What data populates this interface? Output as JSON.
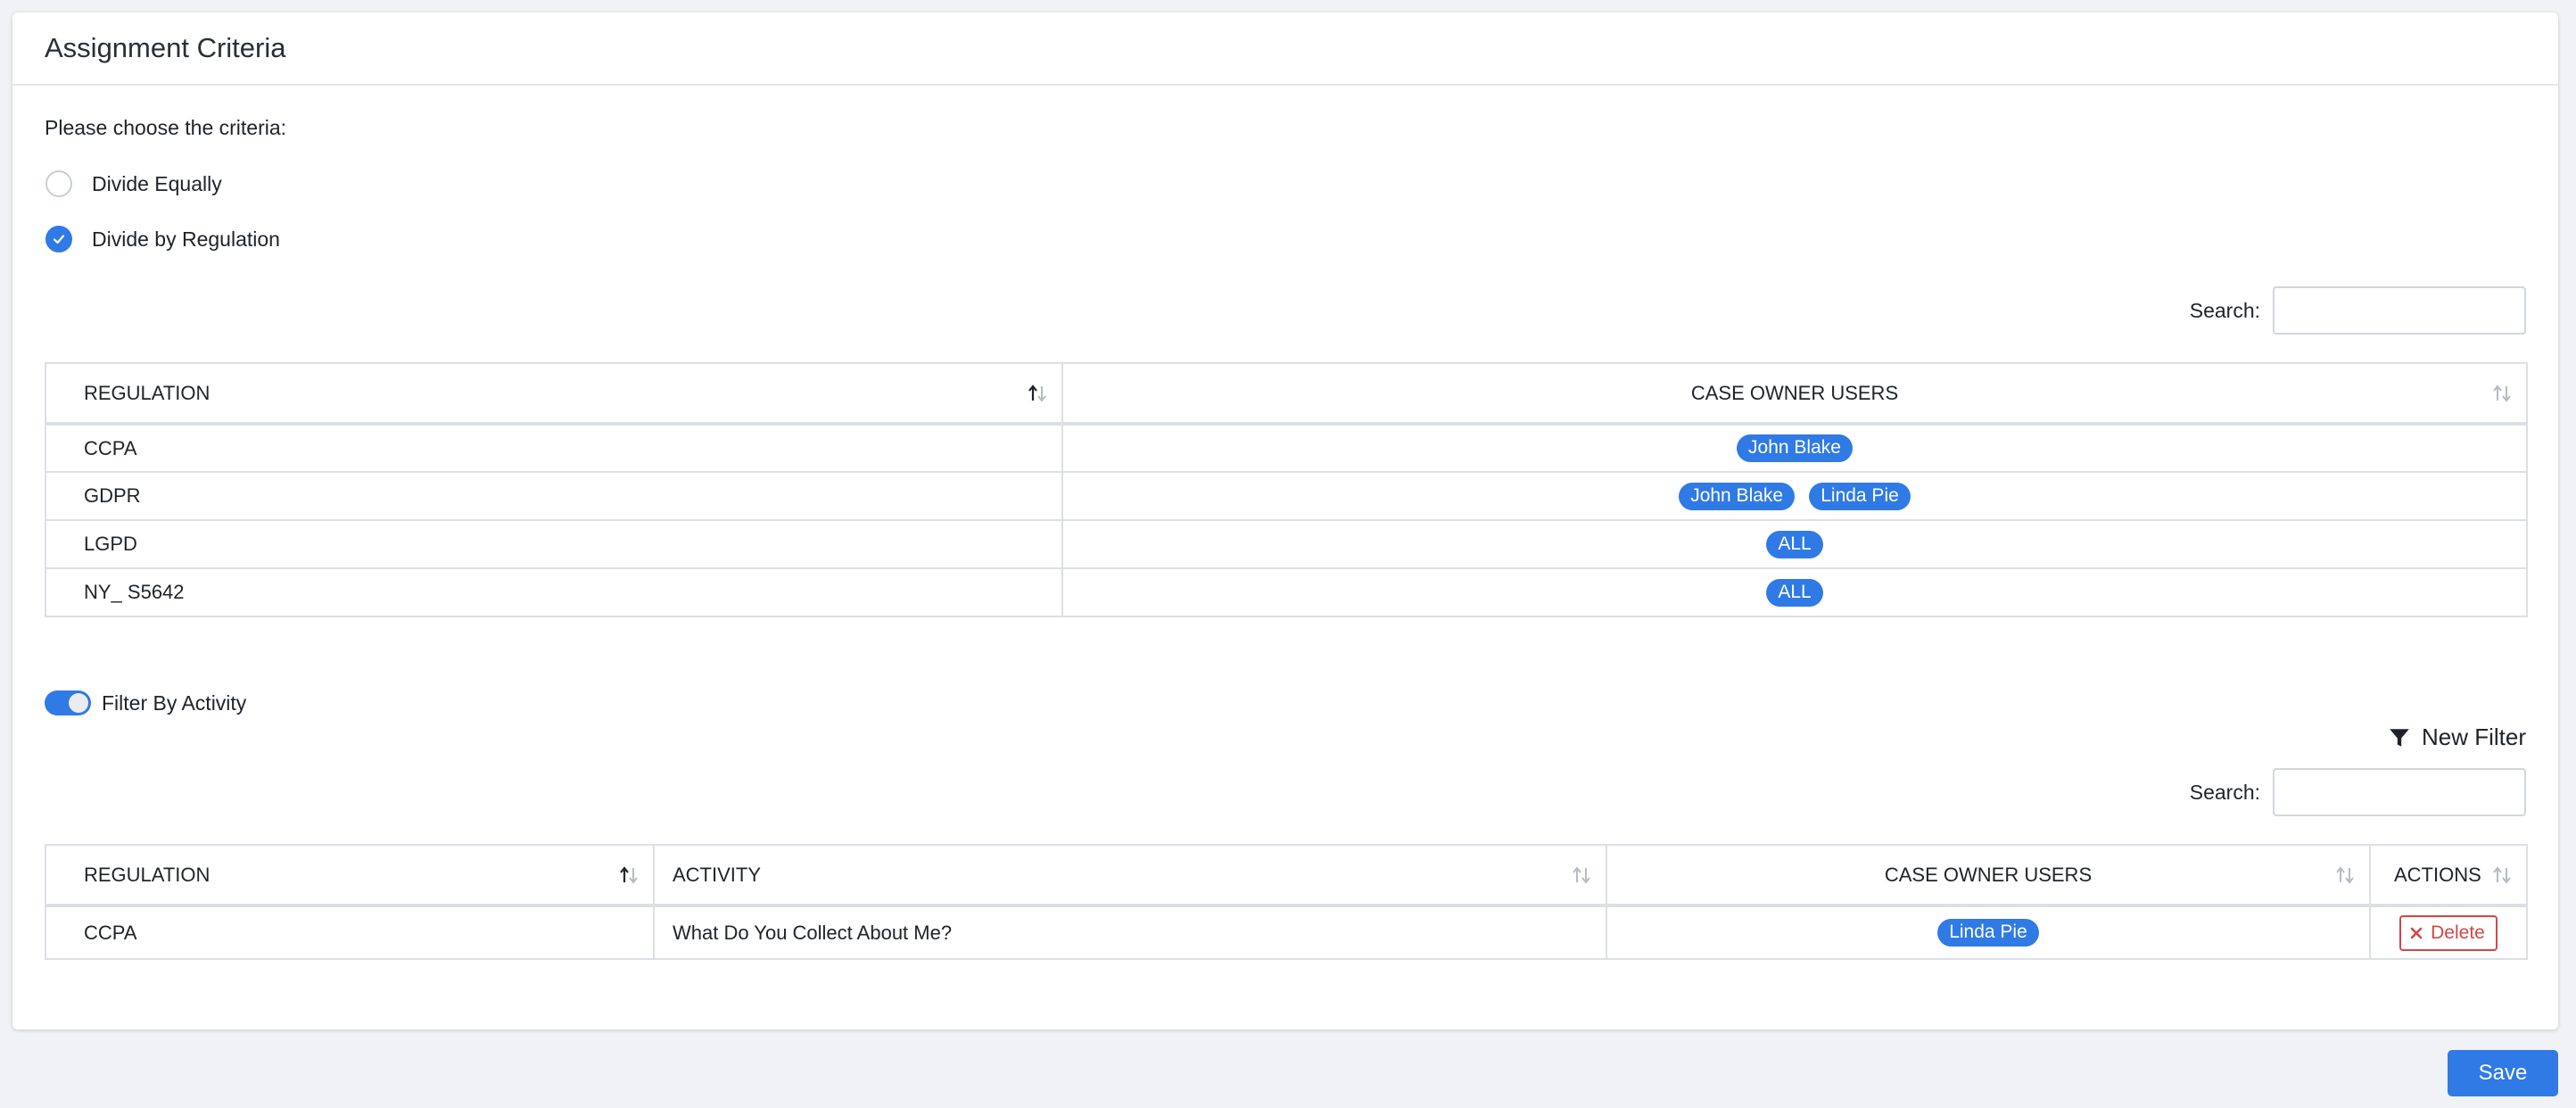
{
  "card": {
    "title": "Assignment Criteria",
    "prompt": "Please choose the criteria:"
  },
  "criteria": {
    "options": [
      {
        "label": "Divide Equally",
        "checked": false
      },
      {
        "label": "Divide by Regulation",
        "checked": true
      }
    ]
  },
  "regulation_table": {
    "search_label": "Search:",
    "search_value": "",
    "columns": [
      "REGULATION",
      "CASE OWNER USERS"
    ],
    "rows": [
      {
        "regulation": "CCPA",
        "users": [
          "John Blake"
        ]
      },
      {
        "regulation": "GDPR",
        "users": [
          "John Blake",
          "Linda Pie"
        ]
      },
      {
        "regulation": "LGPD",
        "users": [
          "ALL"
        ]
      },
      {
        "regulation": "NY_ S5642",
        "users": [
          "ALL"
        ]
      }
    ]
  },
  "filter": {
    "toggle_label": "Filter By Activity",
    "toggle_on": true,
    "new_filter_label": "New Filter"
  },
  "activity_table": {
    "search_label": "Search:",
    "search_value": "",
    "columns": [
      "REGULATION",
      "ACTIVITY",
      "CASE OWNER USERS",
      "ACTIONS"
    ],
    "rows": [
      {
        "regulation": "CCPA",
        "activity": "What Do You Collect About Me?",
        "users": [
          "Linda Pie"
        ],
        "action": "Delete"
      }
    ]
  },
  "footer": {
    "save_label": "Save"
  },
  "colors": {
    "accent": "#2f7ae5",
    "danger": "#d64545"
  }
}
